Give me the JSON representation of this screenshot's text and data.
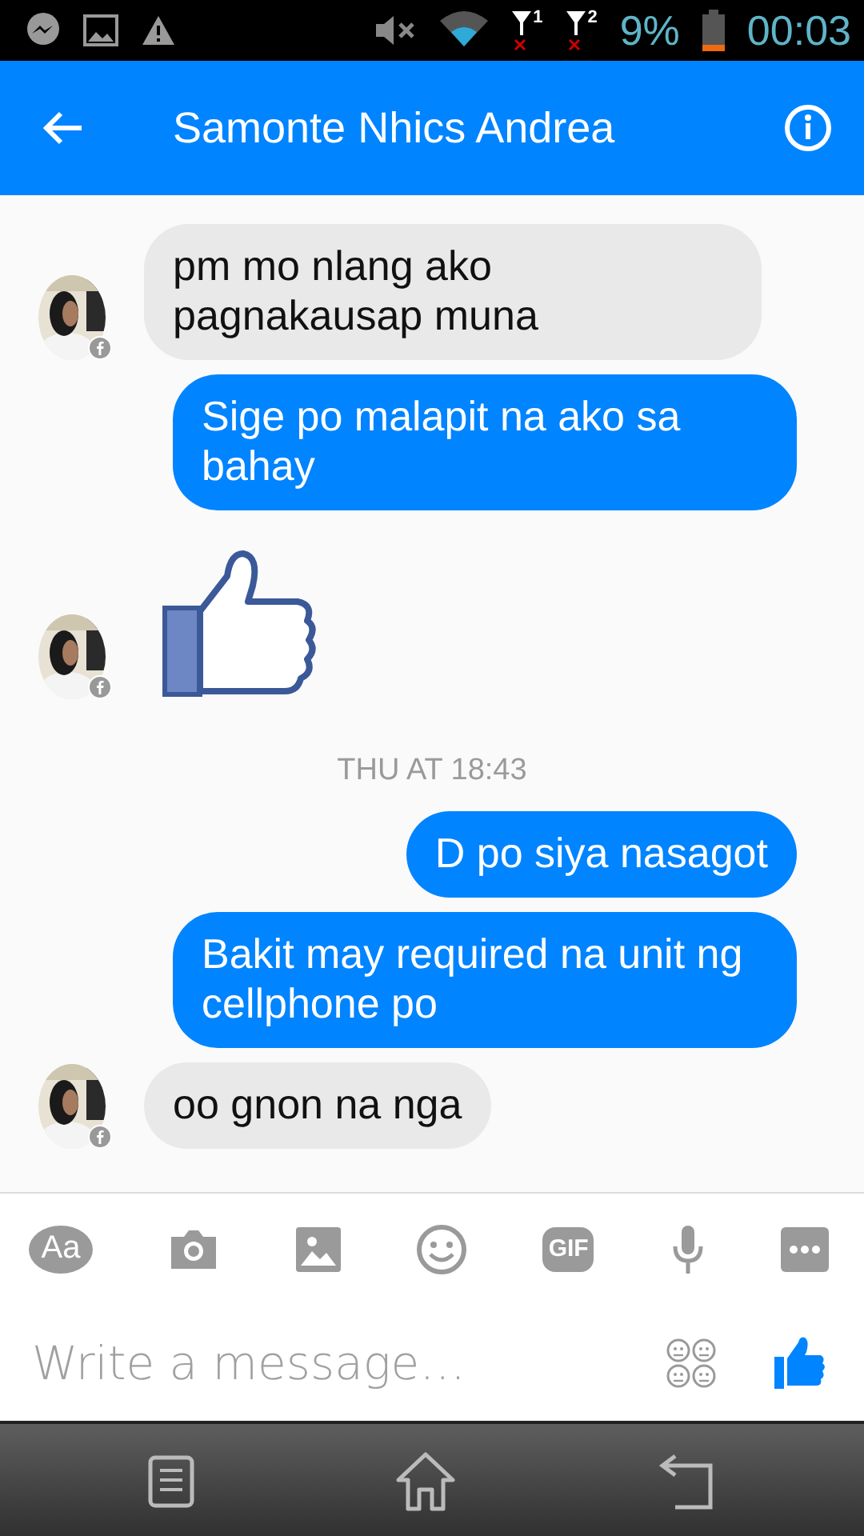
{
  "status_bar": {
    "sim_1": "1",
    "sim_2": "2",
    "battery_percent": "9%",
    "time": "00:03"
  },
  "header": {
    "title": "Samonte Nhics Andrea"
  },
  "messages": [
    {
      "kind": "received",
      "text": "pm mo nlang ako pagnakausap muna",
      "avatar": true
    },
    {
      "kind": "sent",
      "text": "Sige po malapit na ako sa bahay"
    },
    {
      "kind": "like",
      "avatar": true
    },
    {
      "kind": "time",
      "text": "THU AT 18:43"
    },
    {
      "kind": "sent",
      "text": "D po siya nasagot"
    },
    {
      "kind": "sent",
      "text": "Bakit may required na unit ng cellphone po"
    },
    {
      "kind": "received",
      "text": "oo gnon na nga",
      "avatar": true
    }
  ],
  "toolbar": {
    "text_button": "Aa",
    "gif_button": "GIF"
  },
  "composer": {
    "placeholder": "Write a message…"
  }
}
